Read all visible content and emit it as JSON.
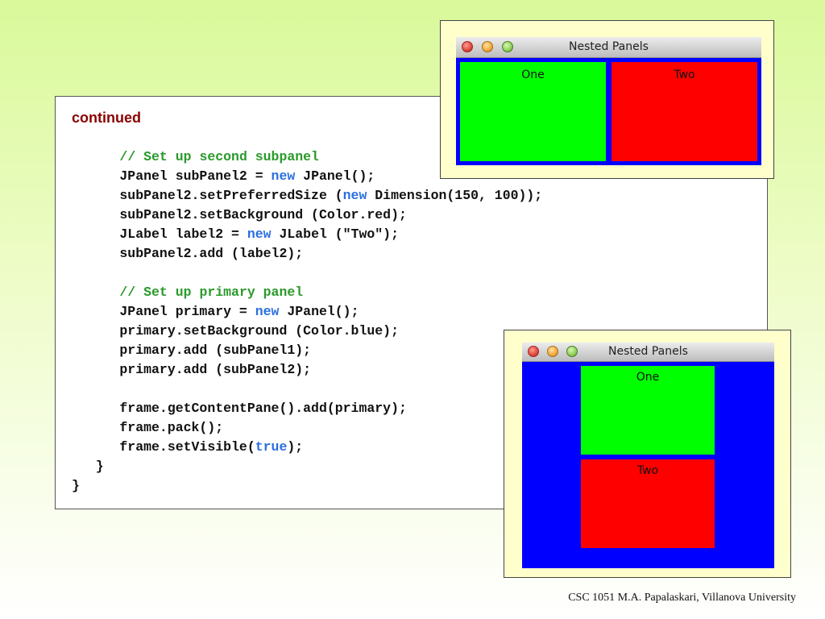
{
  "slide": {
    "continued": "continued",
    "footer": "CSC 1051 M.A. Papalaskari, Villanova University"
  },
  "code": {
    "lines": [
      [
        {
          "t": "      "
        },
        {
          "t": "// Set up second subpanel",
          "c": "cmt"
        }
      ],
      [
        {
          "t": "      JPanel subPanel2 = "
        },
        {
          "t": "new",
          "c": "kw"
        },
        {
          "t": " JPanel();"
        }
      ],
      [
        {
          "t": "      subPanel2.setPreferredSize ("
        },
        {
          "t": "new",
          "c": "kw"
        },
        {
          "t": " Dimension(150, 100));"
        }
      ],
      [
        {
          "t": "      subPanel2.setBackground (Color.red);"
        }
      ],
      [
        {
          "t": "      JLabel label2 = "
        },
        {
          "t": "new",
          "c": "kw"
        },
        {
          "t": " JLabel (\"Two\");"
        }
      ],
      [
        {
          "t": "      subPanel2.add (label2);"
        }
      ],
      [
        {
          "t": ""
        }
      ],
      [
        {
          "t": "      "
        },
        {
          "t": "// Set up primary panel",
          "c": "cmt"
        }
      ],
      [
        {
          "t": "      JPanel primary = "
        },
        {
          "t": "new",
          "c": "kw"
        },
        {
          "t": " JPanel();"
        }
      ],
      [
        {
          "t": "      primary.setBackground (Color.blue);"
        }
      ],
      [
        {
          "t": "      primary.add (subPanel1);"
        }
      ],
      [
        {
          "t": "      primary.add (subPanel2);"
        }
      ],
      [
        {
          "t": ""
        }
      ],
      [
        {
          "t": "      frame.getContentPane().add(primary);"
        }
      ],
      [
        {
          "t": "      frame.pack();"
        }
      ],
      [
        {
          "t": "      frame.setVisible("
        },
        {
          "t": "true",
          "c": "kw"
        },
        {
          "t": ");"
        }
      ],
      [
        {
          "t": "   }"
        }
      ],
      [
        {
          "t": "}"
        }
      ]
    ]
  },
  "window1": {
    "title": "Nested Panels",
    "panel1_label": "One",
    "panel2_label": "Two"
  },
  "window2": {
    "title": "Nested Panels",
    "panel1_label": "One",
    "panel2_label": "Two"
  },
  "colors": {
    "primary_panel": "#0000ff",
    "subpanel1": "#00ff00",
    "subpanel2": "#ff0000",
    "comment": "#2a9a2a",
    "keyword": "#2b6fe0",
    "continued": "#8b0000"
  }
}
